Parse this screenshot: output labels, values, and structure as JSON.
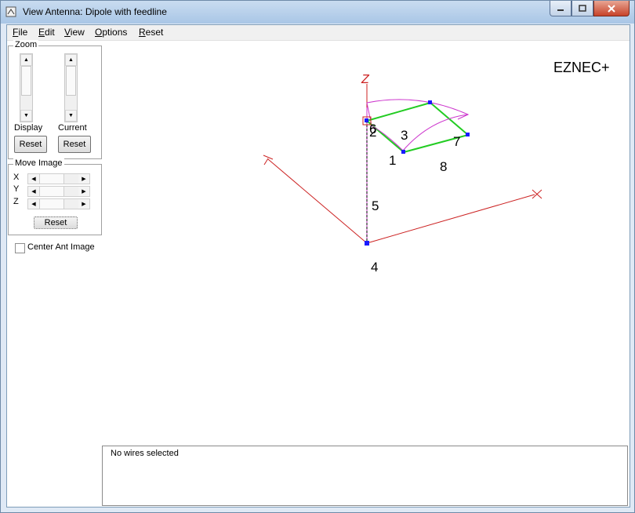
{
  "window": {
    "title": "View Antenna: Dipole with feedline"
  },
  "menu": {
    "items": [
      {
        "label": "File",
        "key": "F",
        "rest": "ile"
      },
      {
        "label": "Edit",
        "key": "E",
        "rest": "dit"
      },
      {
        "label": "View",
        "key": "V",
        "rest": "iew"
      },
      {
        "label": "Options",
        "key": "O",
        "rest": "ptions"
      },
      {
        "label": "Reset",
        "key": "R",
        "rest": "eset"
      }
    ]
  },
  "zoom": {
    "group_label": "Zoom",
    "display_label": "Display",
    "current_label": "Current",
    "reset_label": "Reset"
  },
  "move_image": {
    "group_label": "Move Image",
    "axes": [
      "X",
      "Y",
      "Z"
    ],
    "reset_label": "Reset"
  },
  "center_ant": {
    "label": "Center Ant Image",
    "checked": false
  },
  "canvas": {
    "brand": "EZNEC+",
    "axis_labels": {
      "x": "X",
      "y": "Y",
      "z": "Z"
    },
    "wire_numbers": [
      "1",
      "2",
      "3",
      "4",
      "5",
      "6",
      "7",
      "8"
    ]
  },
  "status": {
    "text": "No wires selected"
  },
  "colors": {
    "axis": "#cc2222",
    "wire": "#22cc22",
    "pattern": "#cc33cc",
    "feedline": "#000000"
  }
}
